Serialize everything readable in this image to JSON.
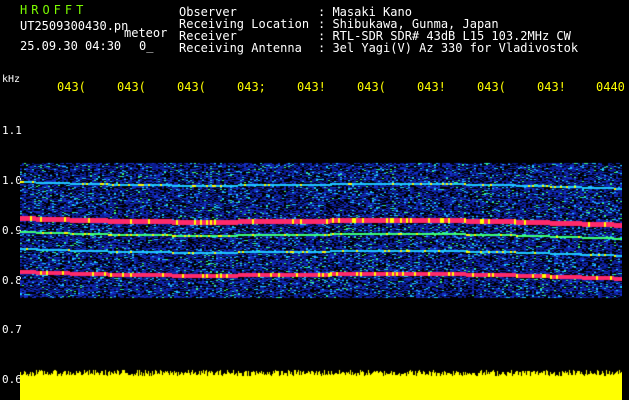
{
  "header": {
    "logo": "HROFFT",
    "filename": "UT2509300430.pn",
    "mode": "meteor",
    "datetime": "25.09.30 04:30",
    "count": "0_"
  },
  "info": [
    {
      "label": "Observer",
      "value": ": Masaki Kano"
    },
    {
      "label": "Receiving Location",
      "value": ": Shibukawa, Gunma, Japan"
    },
    {
      "label": "Receiver",
      "value": ": RTL-SDR SDR# 43dB L15 103.2MHz CW"
    },
    {
      "label": "Receiving Antenna",
      "value": ": 3el Yagi(V) Az 330 for Vladivostok"
    }
  ],
  "axis": {
    "unit": "kHz",
    "y_labels": [
      "1.1",
      "1.0",
      "0.9",
      "0.8",
      "0.7",
      "0.6"
    ],
    "x_labels": [
      "043(",
      "043(",
      "043(",
      "043;",
      "043!",
      "043(",
      "043!",
      "043(",
      "043!",
      "0440"
    ]
  },
  "colors": {
    "background": "#000000",
    "header_green": "#7CFC00",
    "time_labels": "#ffff00",
    "signal_low": "#0a1aa0",
    "signal_mid": "#1ec8ff",
    "signal_high": "#ff2a6a",
    "bar": "#ffff00"
  }
}
